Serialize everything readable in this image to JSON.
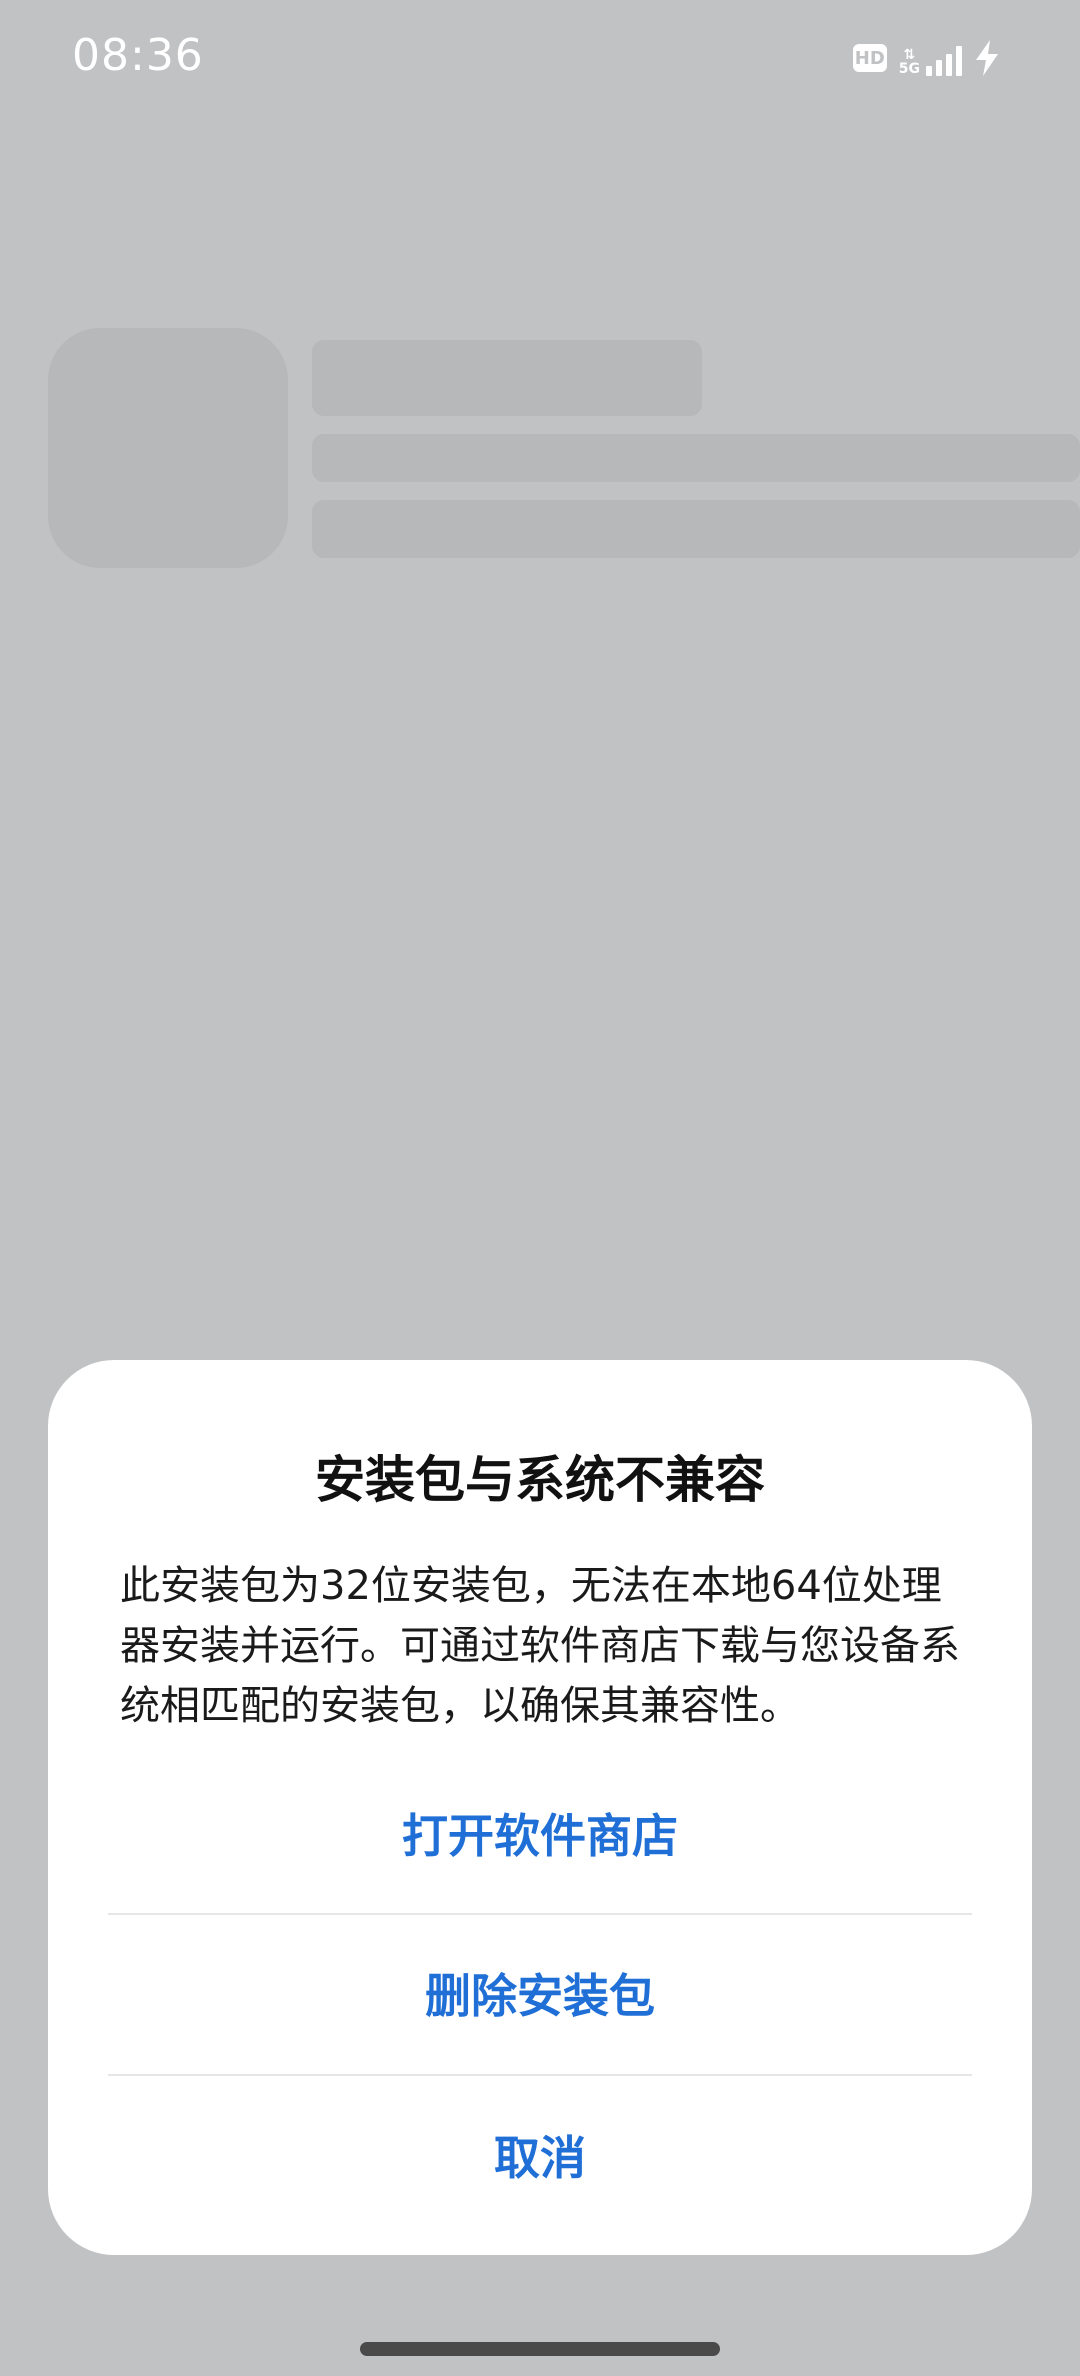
{
  "status_bar": {
    "time": "08:36",
    "hd_label": "HD",
    "network_label": "5G",
    "icons": [
      "hd-icon",
      "signal-5g-icon",
      "charging-icon"
    ]
  },
  "dialog": {
    "title": "安装包与系统不兼容",
    "message": "此安装包为32位安装包，无法在本地64位处理器安装并运行。可通过软件商店下载与您设备系统相匹配的安装包，以确保其兼容性。",
    "actions": {
      "open_store": "打开软件商店",
      "delete_package": "删除安装包",
      "cancel": "取消"
    }
  },
  "colors": {
    "background_dim": "#c1c2c4",
    "dialog_bg": "#ffffff",
    "action_blue": "#1f6fd6",
    "title_text": "#111111"
  }
}
